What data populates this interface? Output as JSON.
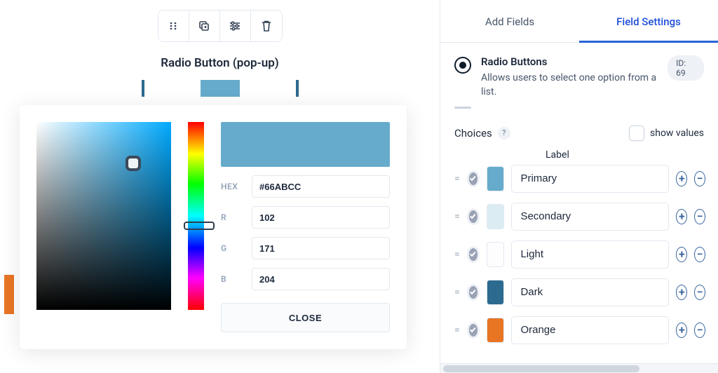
{
  "left": {
    "field_title": "Radio Button (pop-up)"
  },
  "picker": {
    "hex_label": "HEX",
    "hex": "#66ABCC",
    "r_label": "R",
    "r": "102",
    "g_label": "G",
    "g": "171",
    "b_label": "B",
    "b": "204",
    "close": "CLOSE",
    "preview_color": "#66abcc"
  },
  "right": {
    "tabs": {
      "add": "Add Fields",
      "settings": "Field Settings"
    },
    "header": {
      "title": "Radio Buttons",
      "desc": "Allows users to select one option from a list.",
      "id_badge": "ID: 69"
    },
    "choices_title": "Choices",
    "show_values": "show values",
    "label_col": "Label",
    "choices": [
      {
        "label": "Primary",
        "color": "#66abcc"
      },
      {
        "label": "Secondary",
        "color": "#dbecf3"
      },
      {
        "label": "Light",
        "color": "#fdfdfe"
      },
      {
        "label": "Dark",
        "color": "#2c6a8f"
      },
      {
        "label": "Orange",
        "color": "#e87524"
      }
    ]
  }
}
